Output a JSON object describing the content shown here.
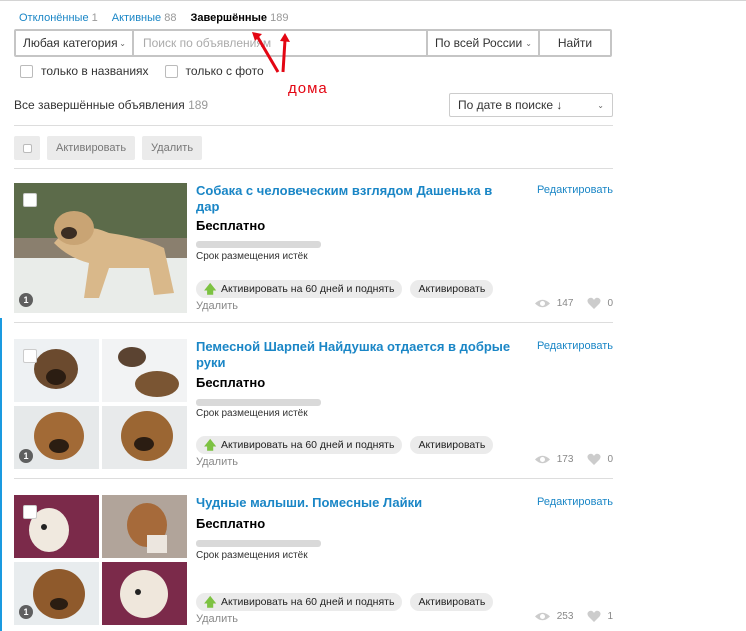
{
  "tabs": [
    {
      "label": "Отклонённые",
      "count": "1"
    },
    {
      "label": "Активные",
      "count": "88"
    },
    {
      "label": "Завершённые",
      "count": "189"
    }
  ],
  "search": {
    "category": "Любая категория",
    "placeholder": "Поиск по объявлениям",
    "region": "По всей России",
    "find": "Найти"
  },
  "filters": {
    "titles_only": "только в названиях",
    "with_photo": "только с фото"
  },
  "annotation": "дома",
  "summary": {
    "label": "Все завершённые объявления",
    "count": "189"
  },
  "sort": {
    "label": "По дате в поиске ↓"
  },
  "bulk": {
    "activate": "Активировать",
    "delete": "Удалить"
  },
  "ads": [
    {
      "title": "Собака с человеческим взглядом Дашенька в дар",
      "price": "Бесплатно",
      "expire": "Срок размещения истёк",
      "activate60": "Активировать на 60 дней и поднять",
      "activate": "Активировать",
      "delete": "Удалить",
      "edit": "Редактировать",
      "views": "147",
      "likes": "0",
      "photos": "1"
    },
    {
      "title": "Пемесной Шарпей Найдушка отдается в добрые руки",
      "price": "Бесплатно",
      "expire": "Срок размещения истёк",
      "activate60": "Активировать на 60 дней и поднять",
      "activate": "Активировать",
      "delete": "Удалить",
      "edit": "Редактировать",
      "views": "173",
      "likes": "0",
      "photos": "1"
    },
    {
      "title": "Чудные малыши. Помесные Лайки",
      "price": "Бесплатно",
      "expire": "Срок размещения истёк",
      "activate60": "Активировать на 60 дней и поднять",
      "activate": "Активировать",
      "delete": "Удалить",
      "edit": "Редактировать",
      "views": "253",
      "likes": "1",
      "photos": "1"
    }
  ],
  "colors": {
    "link": "#1a86c6",
    "annotation": "#e30613",
    "activate_arrow": "#7dc242"
  }
}
